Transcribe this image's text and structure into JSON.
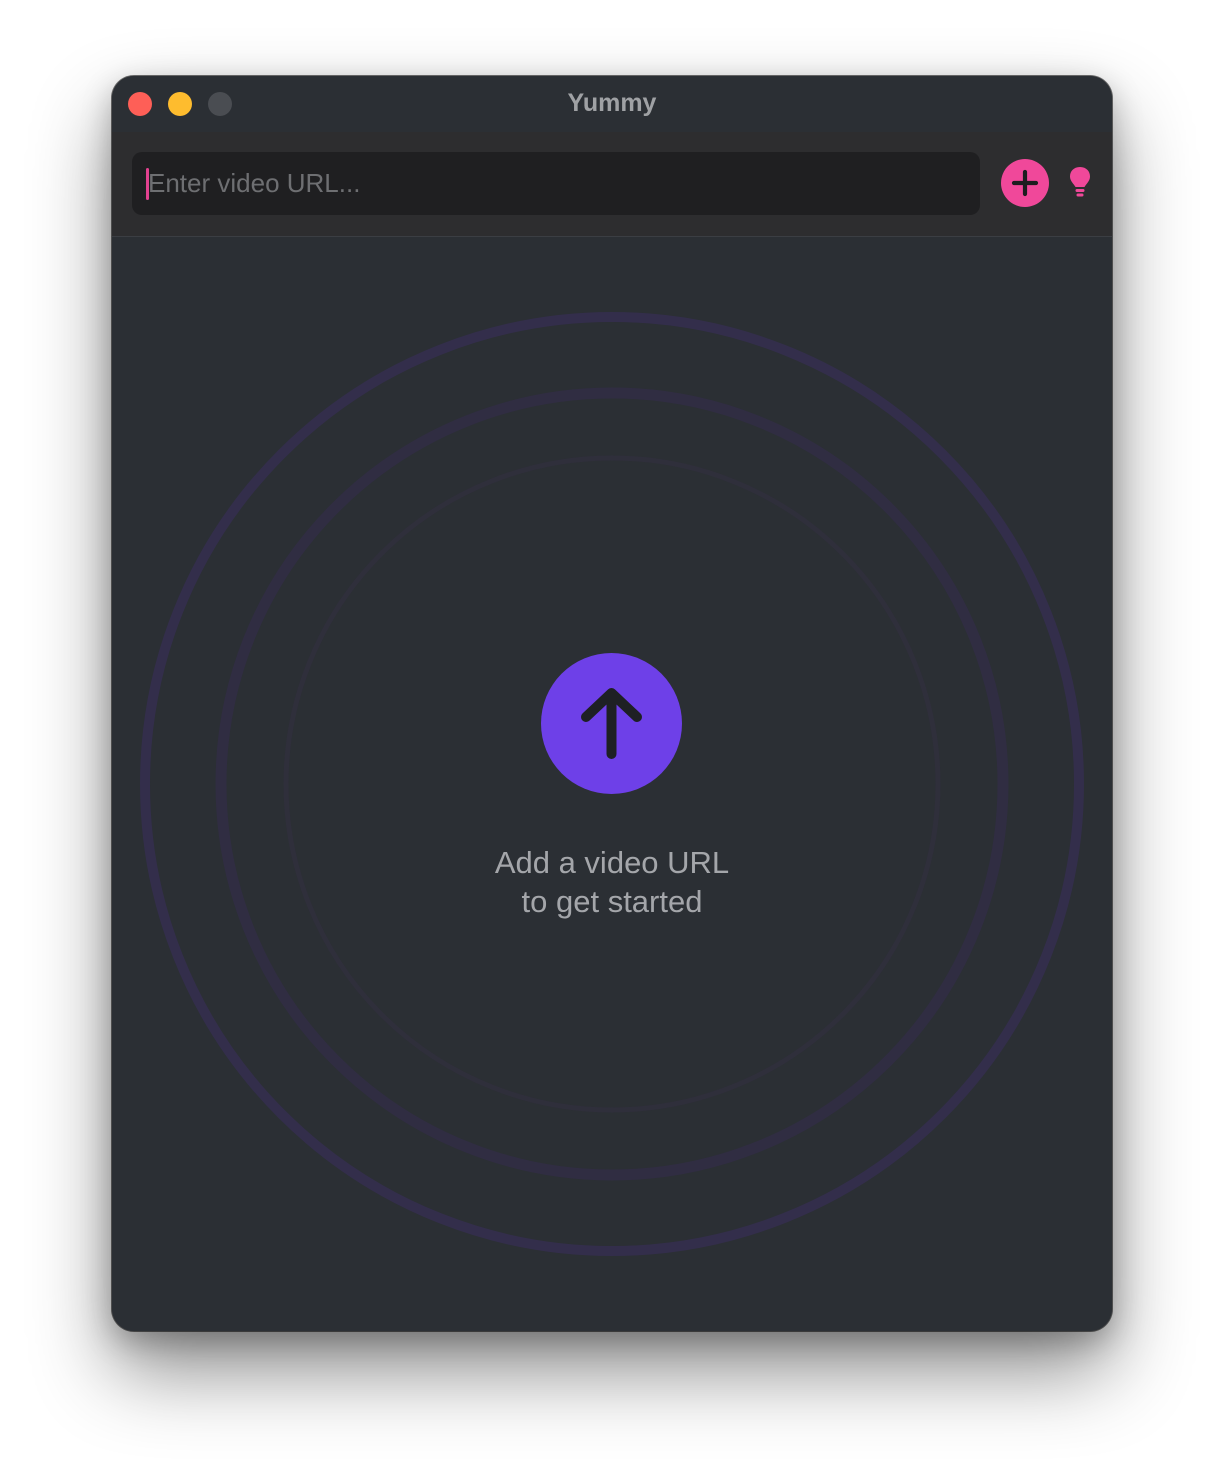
{
  "window": {
    "title": "Yummy"
  },
  "traffic_lights": {
    "close_color": "#fe5f57",
    "minimize_color": "#febc2e",
    "zoom_color": "#4a4d52"
  },
  "toolbar": {
    "url_input": {
      "value": "",
      "placeholder": "Enter video URL..."
    },
    "add_button_icon": "plus-icon",
    "tips_button_icon": "lightbulb-icon"
  },
  "empty_state": {
    "icon": "arrow-up-icon",
    "line1": "Add a video URL",
    "line2": "to get started"
  },
  "colors": {
    "accent_pink": "#f0489a",
    "accent_purple": "#6e40e8",
    "ring_outer": "#332e4b",
    "ring_mid": "#302d42",
    "ring_inner": "#2f2f3b",
    "background": "#2b2f34"
  }
}
